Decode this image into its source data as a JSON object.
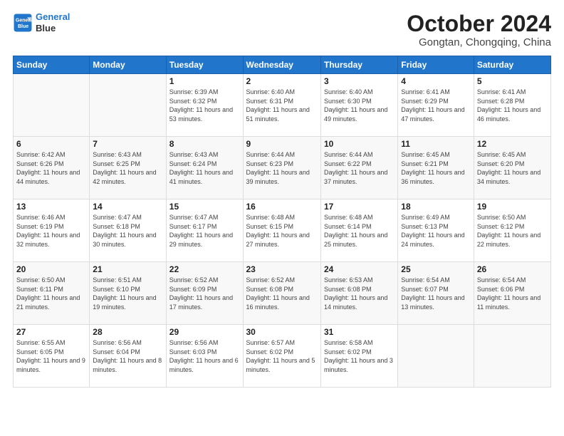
{
  "logo": {
    "line1": "General",
    "line2": "Blue"
  },
  "title": "October 2024",
  "subtitle": "Gongtan, Chongqing, China",
  "headers": [
    "Sunday",
    "Monday",
    "Tuesday",
    "Wednesday",
    "Thursday",
    "Friday",
    "Saturday"
  ],
  "weeks": [
    [
      {
        "day": "",
        "info": ""
      },
      {
        "day": "",
        "info": ""
      },
      {
        "day": "1",
        "info": "Sunrise: 6:39 AM\nSunset: 6:32 PM\nDaylight: 11 hours and 53 minutes."
      },
      {
        "day": "2",
        "info": "Sunrise: 6:40 AM\nSunset: 6:31 PM\nDaylight: 11 hours and 51 minutes."
      },
      {
        "day": "3",
        "info": "Sunrise: 6:40 AM\nSunset: 6:30 PM\nDaylight: 11 hours and 49 minutes."
      },
      {
        "day": "4",
        "info": "Sunrise: 6:41 AM\nSunset: 6:29 PM\nDaylight: 11 hours and 47 minutes."
      },
      {
        "day": "5",
        "info": "Sunrise: 6:41 AM\nSunset: 6:28 PM\nDaylight: 11 hours and 46 minutes."
      }
    ],
    [
      {
        "day": "6",
        "info": "Sunrise: 6:42 AM\nSunset: 6:26 PM\nDaylight: 11 hours and 44 minutes."
      },
      {
        "day": "7",
        "info": "Sunrise: 6:43 AM\nSunset: 6:25 PM\nDaylight: 11 hours and 42 minutes."
      },
      {
        "day": "8",
        "info": "Sunrise: 6:43 AM\nSunset: 6:24 PM\nDaylight: 11 hours and 41 minutes."
      },
      {
        "day": "9",
        "info": "Sunrise: 6:44 AM\nSunset: 6:23 PM\nDaylight: 11 hours and 39 minutes."
      },
      {
        "day": "10",
        "info": "Sunrise: 6:44 AM\nSunset: 6:22 PM\nDaylight: 11 hours and 37 minutes."
      },
      {
        "day": "11",
        "info": "Sunrise: 6:45 AM\nSunset: 6:21 PM\nDaylight: 11 hours and 36 minutes."
      },
      {
        "day": "12",
        "info": "Sunrise: 6:45 AM\nSunset: 6:20 PM\nDaylight: 11 hours and 34 minutes."
      }
    ],
    [
      {
        "day": "13",
        "info": "Sunrise: 6:46 AM\nSunset: 6:19 PM\nDaylight: 11 hours and 32 minutes."
      },
      {
        "day": "14",
        "info": "Sunrise: 6:47 AM\nSunset: 6:18 PM\nDaylight: 11 hours and 30 minutes."
      },
      {
        "day": "15",
        "info": "Sunrise: 6:47 AM\nSunset: 6:17 PM\nDaylight: 11 hours and 29 minutes."
      },
      {
        "day": "16",
        "info": "Sunrise: 6:48 AM\nSunset: 6:15 PM\nDaylight: 11 hours and 27 minutes."
      },
      {
        "day": "17",
        "info": "Sunrise: 6:48 AM\nSunset: 6:14 PM\nDaylight: 11 hours and 25 minutes."
      },
      {
        "day": "18",
        "info": "Sunrise: 6:49 AM\nSunset: 6:13 PM\nDaylight: 11 hours and 24 minutes."
      },
      {
        "day": "19",
        "info": "Sunrise: 6:50 AM\nSunset: 6:12 PM\nDaylight: 11 hours and 22 minutes."
      }
    ],
    [
      {
        "day": "20",
        "info": "Sunrise: 6:50 AM\nSunset: 6:11 PM\nDaylight: 11 hours and 21 minutes."
      },
      {
        "day": "21",
        "info": "Sunrise: 6:51 AM\nSunset: 6:10 PM\nDaylight: 11 hours and 19 minutes."
      },
      {
        "day": "22",
        "info": "Sunrise: 6:52 AM\nSunset: 6:09 PM\nDaylight: 11 hours and 17 minutes."
      },
      {
        "day": "23",
        "info": "Sunrise: 6:52 AM\nSunset: 6:08 PM\nDaylight: 11 hours and 16 minutes."
      },
      {
        "day": "24",
        "info": "Sunrise: 6:53 AM\nSunset: 6:08 PM\nDaylight: 11 hours and 14 minutes."
      },
      {
        "day": "25",
        "info": "Sunrise: 6:54 AM\nSunset: 6:07 PM\nDaylight: 11 hours and 13 minutes."
      },
      {
        "day": "26",
        "info": "Sunrise: 6:54 AM\nSunset: 6:06 PM\nDaylight: 11 hours and 11 minutes."
      }
    ],
    [
      {
        "day": "27",
        "info": "Sunrise: 6:55 AM\nSunset: 6:05 PM\nDaylight: 11 hours and 9 minutes."
      },
      {
        "day": "28",
        "info": "Sunrise: 6:56 AM\nSunset: 6:04 PM\nDaylight: 11 hours and 8 minutes."
      },
      {
        "day": "29",
        "info": "Sunrise: 6:56 AM\nSunset: 6:03 PM\nDaylight: 11 hours and 6 minutes."
      },
      {
        "day": "30",
        "info": "Sunrise: 6:57 AM\nSunset: 6:02 PM\nDaylight: 11 hours and 5 minutes."
      },
      {
        "day": "31",
        "info": "Sunrise: 6:58 AM\nSunset: 6:02 PM\nDaylight: 11 hours and 3 minutes."
      },
      {
        "day": "",
        "info": ""
      },
      {
        "day": "",
        "info": ""
      }
    ]
  ]
}
